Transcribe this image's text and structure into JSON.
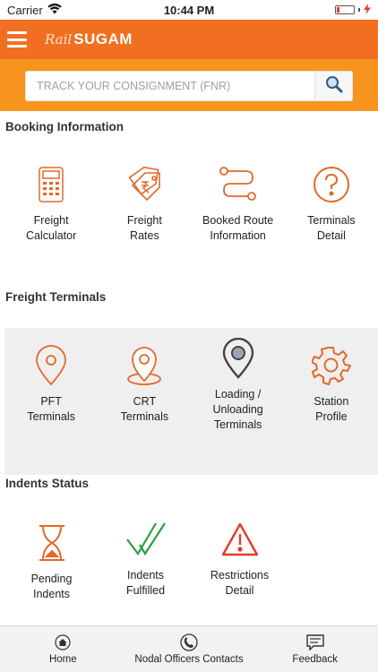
{
  "status_bar": {
    "carrier": "Carrier",
    "time": "10:44 PM",
    "icons": [
      "wifi-icon",
      "battery-icon",
      "charging-icon"
    ]
  },
  "header": {
    "logo_prefix": "Rail",
    "logo_main": "SUGAM",
    "menu_icon": "hamburger-icon",
    "bar_color": "#f26f21"
  },
  "search": {
    "placeholder": "TRACK YOUR CONSIGNMENT (FNR)",
    "value": "",
    "icon": "search-icon",
    "band_color": "#f7941d"
  },
  "sections": {
    "booking": {
      "title": "Booking Information",
      "items": [
        {
          "label": "Freight\nCalculator",
          "icon": "calculator-icon"
        },
        {
          "label": "Freight\nRates",
          "icon": "rupee-tag-icon"
        },
        {
          "label": "Booked Route\nInformation",
          "icon": "route-icon"
        },
        {
          "label": "Terminals\nDetail",
          "icon": "question-circle-icon"
        }
      ]
    },
    "terminals": {
      "title": "Freight Terminals",
      "items": [
        {
          "label": "PFT\nTerminals",
          "icon": "location-pin-icon"
        },
        {
          "label": "CRT\nTerminals",
          "icon": "location-target-icon"
        },
        {
          "label": "Loading /\nUnloading\nTerminals",
          "icon": "location-pin-dark-icon"
        },
        {
          "label": "Station\nProfile",
          "icon": "gear-icon"
        }
      ]
    },
    "indents": {
      "title": "Indents Status",
      "items": [
        {
          "label": "Pending\nIndents",
          "icon": "hourglass-icon"
        },
        {
          "label": "Indents\nFulfilled",
          "icon": "double-check-icon"
        },
        {
          "label": "Restrictions\nDetail",
          "icon": "warning-icon"
        }
      ]
    }
  },
  "bottom_nav": [
    {
      "label": "Home",
      "icon": "home-icon"
    },
    {
      "label": "Nodal Officers Contacts",
      "icon": "phone-icon"
    },
    {
      "label": "Feedback",
      "icon": "feedback-icon"
    }
  ],
  "colors": {
    "icon_orange": "#e06a2a",
    "icon_green": "#2e9e3e",
    "icon_red": "#e23b2b",
    "icon_dark": "#444444"
  }
}
